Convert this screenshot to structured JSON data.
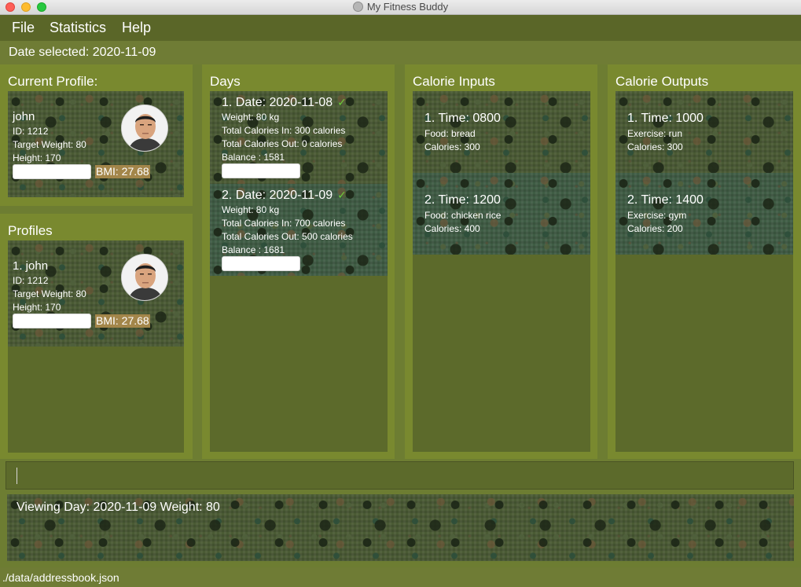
{
  "window": {
    "title": "My Fitness Buddy"
  },
  "menu": {
    "file": "File",
    "statistics": "Statistics",
    "help": "Help"
  },
  "date_selected": "Date selected: 2020-11-09",
  "current_profile": {
    "title": "Current Profile:",
    "name": "john",
    "id": "ID: 1212",
    "target_weight": "Target Weight: 80",
    "height": "Height: 170",
    "bmi": "BMI: 27.68"
  },
  "profiles": {
    "title": "Profiles",
    "items": [
      {
        "index_name": "1.  john",
        "id": "ID: 1212",
        "target_weight": "Target Weight: 80",
        "height": "Height: 170",
        "bmi": "BMI: 27.68"
      }
    ]
  },
  "days": {
    "title": "Days",
    "items": [
      {
        "heading": "1.  Date: 2020-11-08",
        "check": "✓",
        "weight": "Weight: 80 kg",
        "cal_in": "Total Calories In: 300 calories",
        "cal_out": "Total Calories Out: 0 calories",
        "balance": "Balance : 1581"
      },
      {
        "heading": "2.  Date: 2020-11-09",
        "check": "✓",
        "weight": "Weight: 80 kg",
        "cal_in": "Total Calories In: 700 calories",
        "cal_out": "Total Calories Out: 500 calories",
        "balance": "Balance : 1681"
      }
    ]
  },
  "calorie_inputs": {
    "title": "Calorie Inputs",
    "items": [
      {
        "heading": "1.  Time: 0800",
        "detail": "Food: bread",
        "calories": "Calories: 300"
      },
      {
        "heading": "2.  Time: 1200",
        "detail": "Food: chicken rice",
        "calories": "Calories: 400"
      }
    ]
  },
  "calorie_outputs": {
    "title": "Calorie Outputs",
    "items": [
      {
        "heading": "1.  Time: 1000",
        "detail": "Exercise: run",
        "calories": "Calories: 300"
      },
      {
        "heading": "2.  Time: 1400",
        "detail": "Exercise: gym",
        "calories": "Calories: 200"
      }
    ]
  },
  "command": {
    "value": ""
  },
  "result": "Viewing Day: 2020-11-09 Weight: 80",
  "status_path": "./data/addressbook.json",
  "icons": {
    "app": "app-icon",
    "check": "check-icon"
  },
  "colors": {
    "panel": "#79892f",
    "panel_dark": "#5c6a2b",
    "menubar": "#5a6628",
    "bmi_highlight": "#a3864a",
    "check": "#6dcc3a"
  }
}
